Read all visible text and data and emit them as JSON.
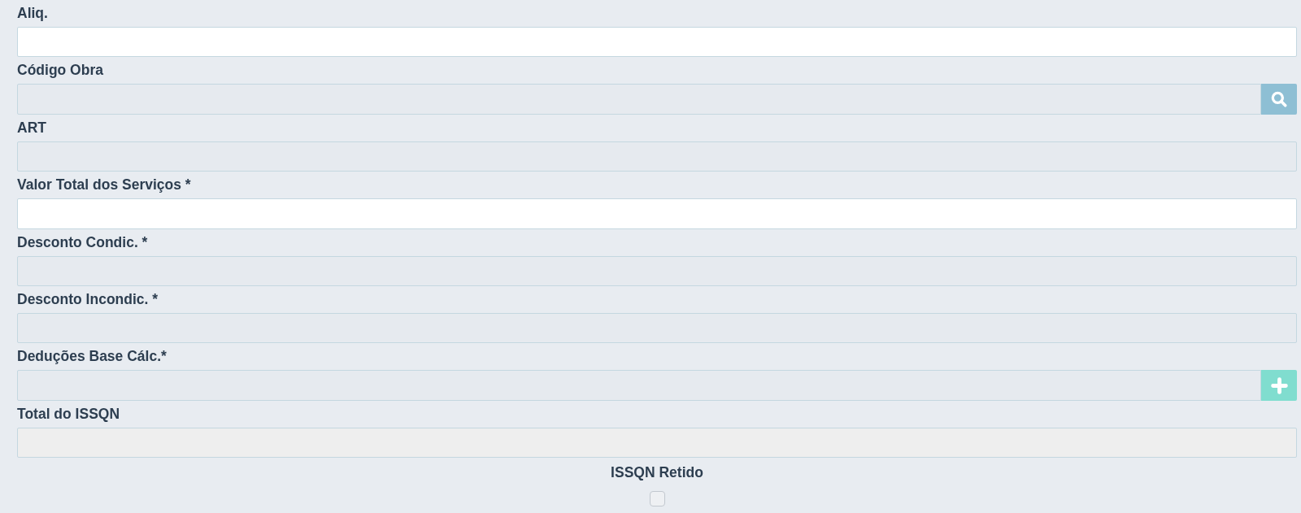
{
  "fields": [
    {
      "label": "Aliq.",
      "disabled": false,
      "readonly": false,
      "kind": "plain"
    },
    {
      "label": "Código Obra",
      "disabled": true,
      "readonly": false,
      "kind": "search"
    },
    {
      "label": "ART",
      "disabled": true,
      "readonly": false,
      "kind": "plain"
    },
    {
      "label": "Valor Total dos Serviços *",
      "disabled": false,
      "readonly": false,
      "kind": "plain"
    },
    {
      "label": "Desconto Condic. *",
      "disabled": true,
      "readonly": false,
      "kind": "plain"
    },
    {
      "label": "Desconto Incondic. *",
      "disabled": true,
      "readonly": false,
      "kind": "plain"
    },
    {
      "label": "Deduções Base Cálc.*",
      "disabled": true,
      "readonly": false,
      "kind": "add"
    },
    {
      "label": "Total do ISSQN",
      "disabled": false,
      "readonly": true,
      "kind": "plain"
    }
  ],
  "retained": {
    "label": "ISSQN Retido",
    "checked": false
  }
}
